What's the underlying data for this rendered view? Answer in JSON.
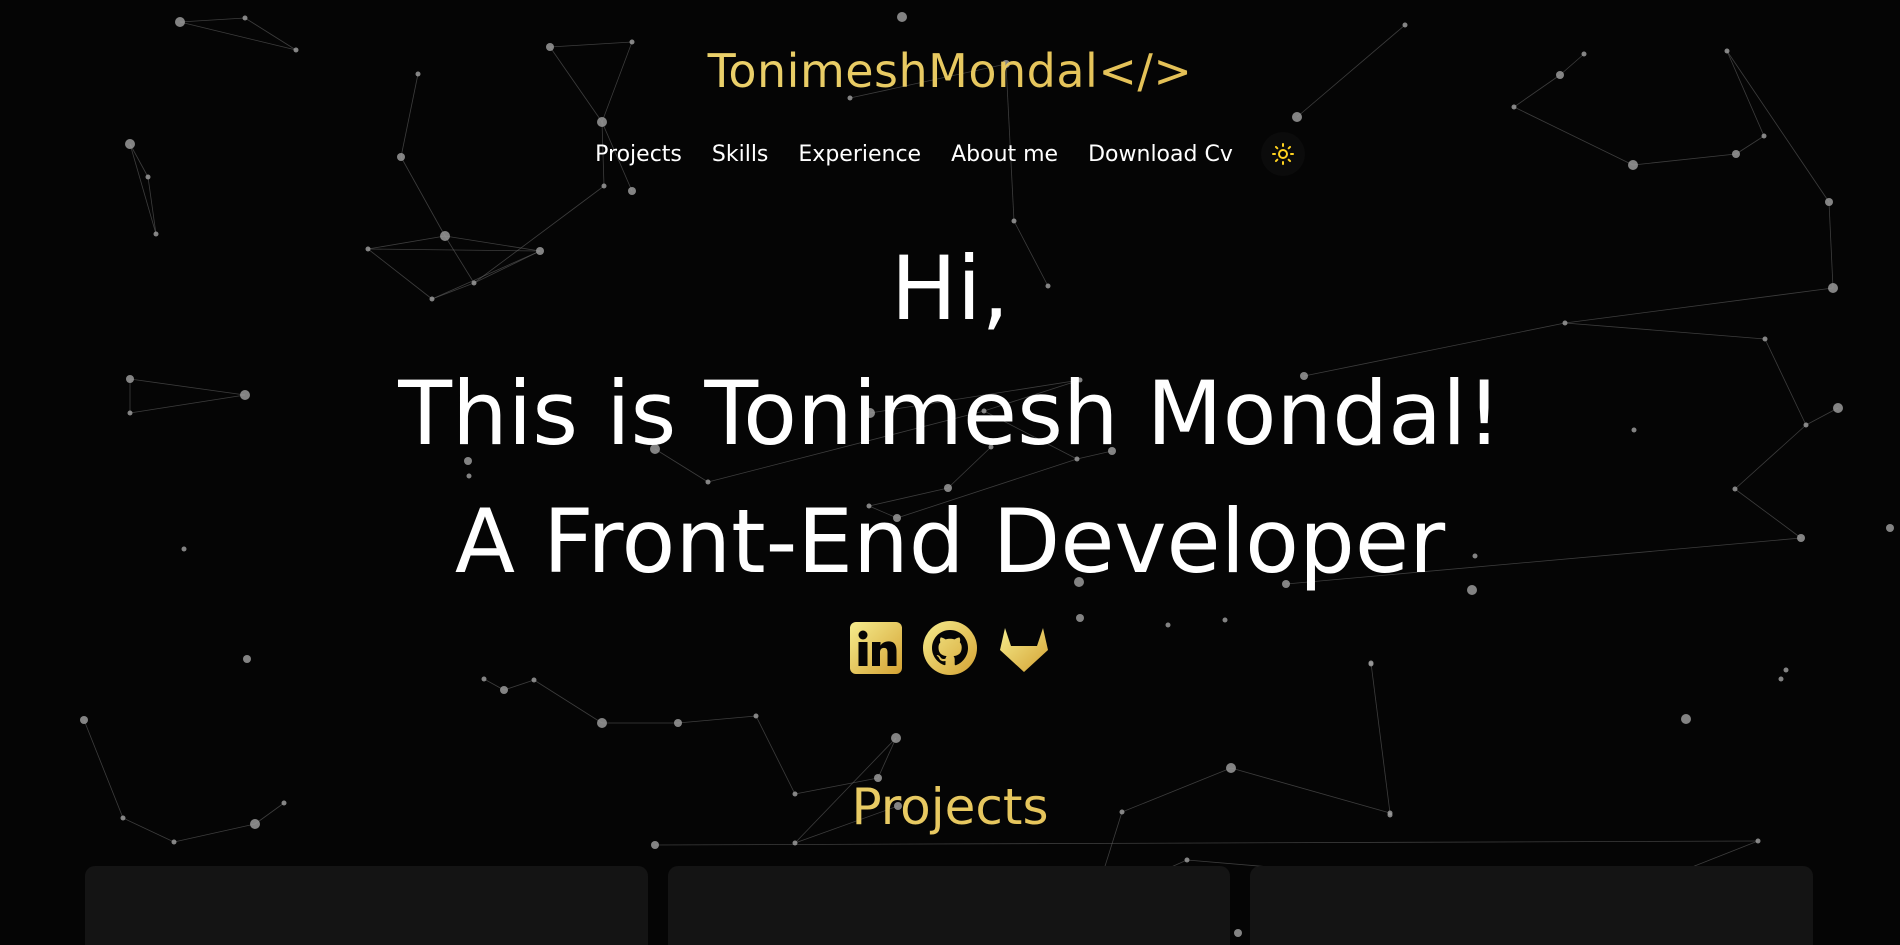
{
  "header": {
    "logo": "TonimeshMondal</>"
  },
  "nav": {
    "items": [
      {
        "label": "Projects"
      },
      {
        "label": "Skills"
      },
      {
        "label": "Experience"
      },
      {
        "label": "About me"
      },
      {
        "label": "Download Cv"
      }
    ],
    "theme_toggle_icon": "sun-icon"
  },
  "hero": {
    "line1": "Hi,",
    "line2": "This is Tonimesh Mondal!",
    "line3": "A Front-End Developer"
  },
  "socials": [
    {
      "name": "LinkedIn",
      "icon": "linkedin-icon"
    },
    {
      "name": "GitHub",
      "icon": "github-icon"
    },
    {
      "name": "GitLab",
      "icon": "gitlab-icon"
    }
  ],
  "projects": {
    "title": "Projects",
    "card_count": 3
  },
  "colors": {
    "background": "#050505",
    "accent_gold_start": "#f3e88a",
    "accent_gold_end": "#d9a93a",
    "text": "#ffffff",
    "card": "#141414"
  }
}
